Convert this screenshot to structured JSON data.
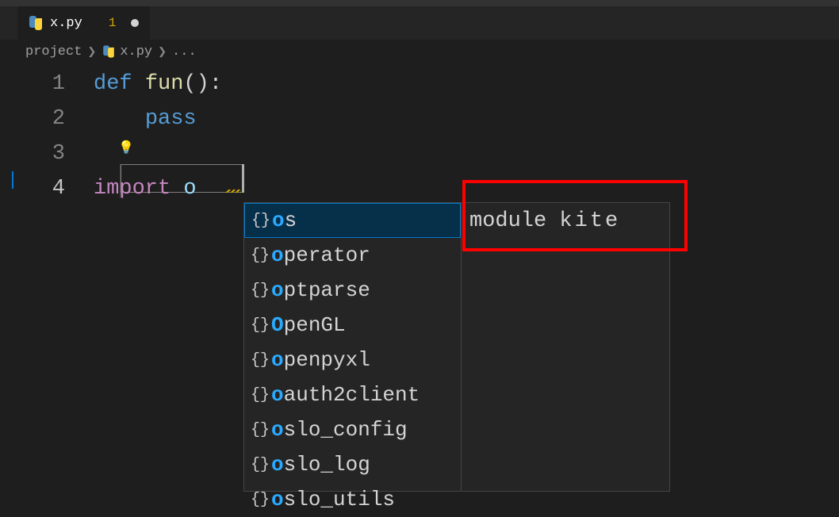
{
  "tab": {
    "filename": "x.py",
    "badge": "1"
  },
  "breadcrumb": {
    "root": "project",
    "file": "x.py",
    "symbol": "..."
  },
  "code": {
    "lines": [
      {
        "num": "1",
        "tokens": [
          {
            "t": "def ",
            "c": "kw-def"
          },
          {
            "t": "fun",
            "c": "fn-name"
          },
          {
            "t": "():",
            "c": "punct"
          }
        ]
      },
      {
        "num": "2",
        "tokens": [
          {
            "t": "    ",
            "c": ""
          },
          {
            "t": "pass",
            "c": "kw-pass"
          }
        ]
      },
      {
        "num": "3",
        "tokens": []
      },
      {
        "num": "4",
        "tokens": [
          {
            "t": "import ",
            "c": "kw-import"
          },
          {
            "t": "o",
            "c": "typed"
          }
        ]
      }
    ]
  },
  "autocomplete": {
    "items": [
      {
        "match": "o",
        "rest": "s"
      },
      {
        "match": "o",
        "rest": "perator"
      },
      {
        "match": "o",
        "rest": "ptparse"
      },
      {
        "match": "O",
        "rest": "penGL"
      },
      {
        "match": "o",
        "rest": "penpyxl"
      },
      {
        "match": "o",
        "rest": "auth2client"
      },
      {
        "match": "o",
        "rest": "slo_config"
      },
      {
        "match": "o",
        "rest": "slo_log"
      },
      {
        "match": "o",
        "rest": "slo_utils"
      }
    ],
    "detail_label": "module",
    "detail_source": "kite"
  }
}
